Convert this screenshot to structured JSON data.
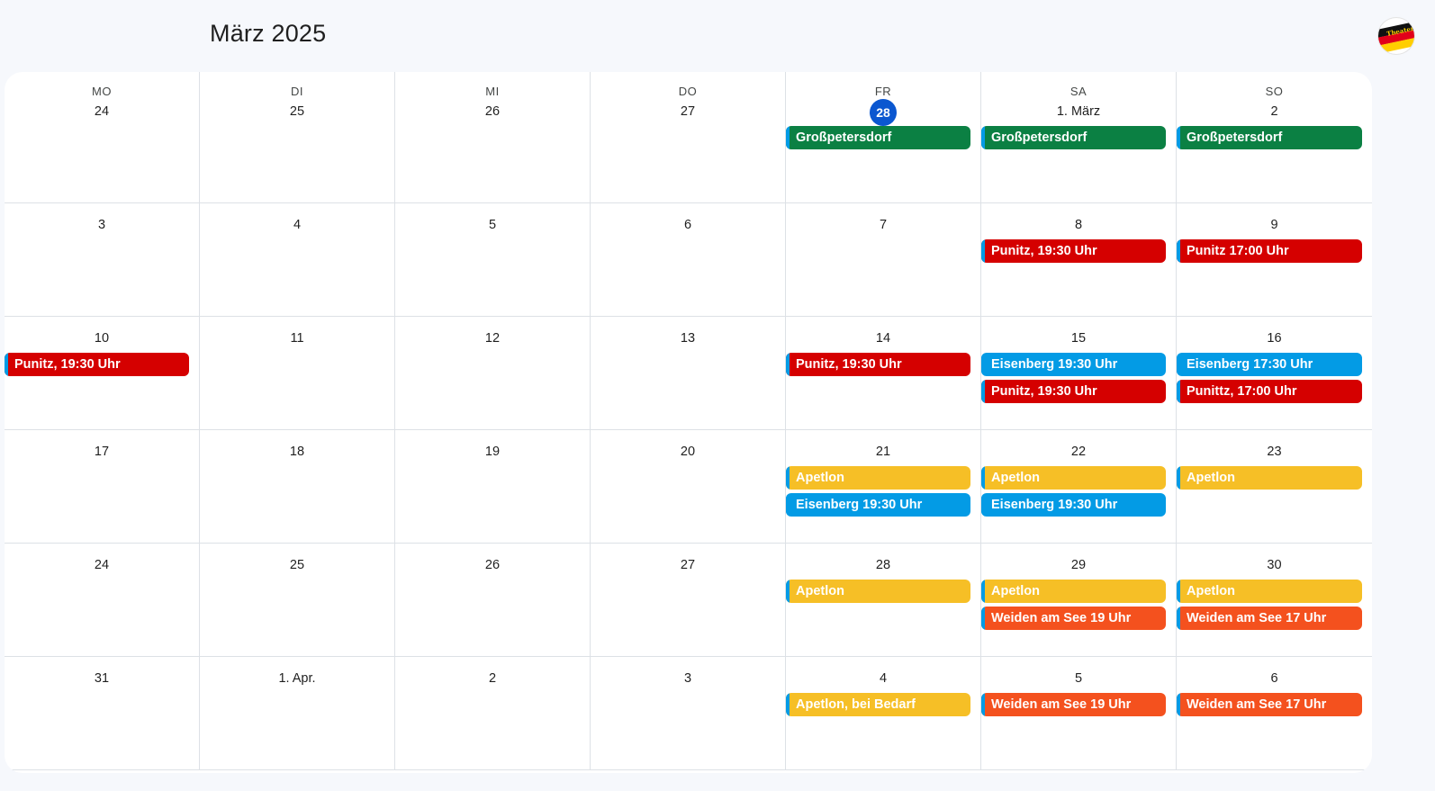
{
  "header": {
    "title": "März 2025"
  },
  "account": {
    "avatar_text": "Theater"
  },
  "colors": {
    "green": "#0b8043",
    "red": "#d50000",
    "blue": "#039be5",
    "yellow": "#f6bf26",
    "orange": "#f4511e",
    "today": "#0b57d0"
  },
  "weekdays": [
    "MO",
    "DI",
    "MI",
    "DO",
    "FR",
    "SA",
    "SO"
  ],
  "weeks": [
    [
      {
        "day": "24",
        "events": []
      },
      {
        "day": "25",
        "events": []
      },
      {
        "day": "26",
        "events": []
      },
      {
        "day": "27",
        "events": []
      },
      {
        "day": "28",
        "today": true,
        "events": [
          {
            "title": "Großpetersdorf",
            "color": "green"
          }
        ]
      },
      {
        "day": "1. März",
        "events": [
          {
            "title": "Großpetersdorf",
            "color": "green"
          }
        ]
      },
      {
        "day": "2",
        "events": [
          {
            "title": "Großpetersdorf",
            "color": "green"
          }
        ]
      }
    ],
    [
      {
        "day": "3",
        "events": []
      },
      {
        "day": "4",
        "events": []
      },
      {
        "day": "5",
        "events": []
      },
      {
        "day": "6",
        "events": []
      },
      {
        "day": "7",
        "events": []
      },
      {
        "day": "8",
        "events": [
          {
            "title": "Punitz, 19:30 Uhr",
            "color": "red"
          }
        ]
      },
      {
        "day": "9",
        "events": [
          {
            "title": "Punitz 17:00 Uhr",
            "color": "red"
          }
        ]
      }
    ],
    [
      {
        "day": "10",
        "events": [
          {
            "title": "Punitz, 19:30 Uhr",
            "color": "red"
          }
        ]
      },
      {
        "day": "11",
        "events": []
      },
      {
        "day": "12",
        "events": []
      },
      {
        "day": "13",
        "events": []
      },
      {
        "day": "14",
        "events": [
          {
            "title": "Punitz, 19:30 Uhr",
            "color": "red"
          }
        ]
      },
      {
        "day": "15",
        "events": [
          {
            "title": "Eisenberg 19:30 Uhr",
            "color": "blue"
          },
          {
            "title": "Punitz, 19:30 Uhr",
            "color": "red"
          }
        ]
      },
      {
        "day": "16",
        "events": [
          {
            "title": "Eisenberg 17:30 Uhr",
            "color": "blue"
          },
          {
            "title": "Punittz, 17:00 Uhr",
            "color": "red"
          }
        ]
      }
    ],
    [
      {
        "day": "17",
        "events": []
      },
      {
        "day": "18",
        "events": []
      },
      {
        "day": "19",
        "events": []
      },
      {
        "day": "20",
        "events": []
      },
      {
        "day": "21",
        "events": [
          {
            "title": "Apetlon",
            "color": "yellow"
          },
          {
            "title": "Eisenberg 19:30 Uhr",
            "color": "blue"
          }
        ]
      },
      {
        "day": "22",
        "events": [
          {
            "title": "Apetlon",
            "color": "yellow"
          },
          {
            "title": "Eisenberg 19:30 Uhr",
            "color": "blue"
          }
        ]
      },
      {
        "day": "23",
        "events": [
          {
            "title": "Apetlon",
            "color": "yellow"
          }
        ]
      }
    ],
    [
      {
        "day": "24",
        "events": []
      },
      {
        "day": "25",
        "events": []
      },
      {
        "day": "26",
        "events": []
      },
      {
        "day": "27",
        "events": []
      },
      {
        "day": "28",
        "events": [
          {
            "title": "Apetlon",
            "color": "yellow"
          }
        ]
      },
      {
        "day": "29",
        "events": [
          {
            "title": "Apetlon",
            "color": "yellow"
          },
          {
            "title": "Weiden am See 19 Uhr",
            "color": "orange"
          }
        ]
      },
      {
        "day": "30",
        "events": [
          {
            "title": "Apetlon",
            "color": "yellow"
          },
          {
            "title": "Weiden am See 17 Uhr",
            "color": "orange"
          }
        ]
      }
    ],
    [
      {
        "day": "31",
        "events": []
      },
      {
        "day": "1. Apr.",
        "events": []
      },
      {
        "day": "2",
        "events": []
      },
      {
        "day": "3",
        "events": []
      },
      {
        "day": "4",
        "events": [
          {
            "title": "Apetlon, bei Bedarf",
            "color": "yellow"
          }
        ]
      },
      {
        "day": "5",
        "events": [
          {
            "title": "Weiden am See 19 Uhr",
            "color": "orange"
          }
        ]
      },
      {
        "day": "6",
        "events": [
          {
            "title": "Weiden am See 17 Uhr",
            "color": "orange"
          }
        ]
      }
    ]
  ]
}
